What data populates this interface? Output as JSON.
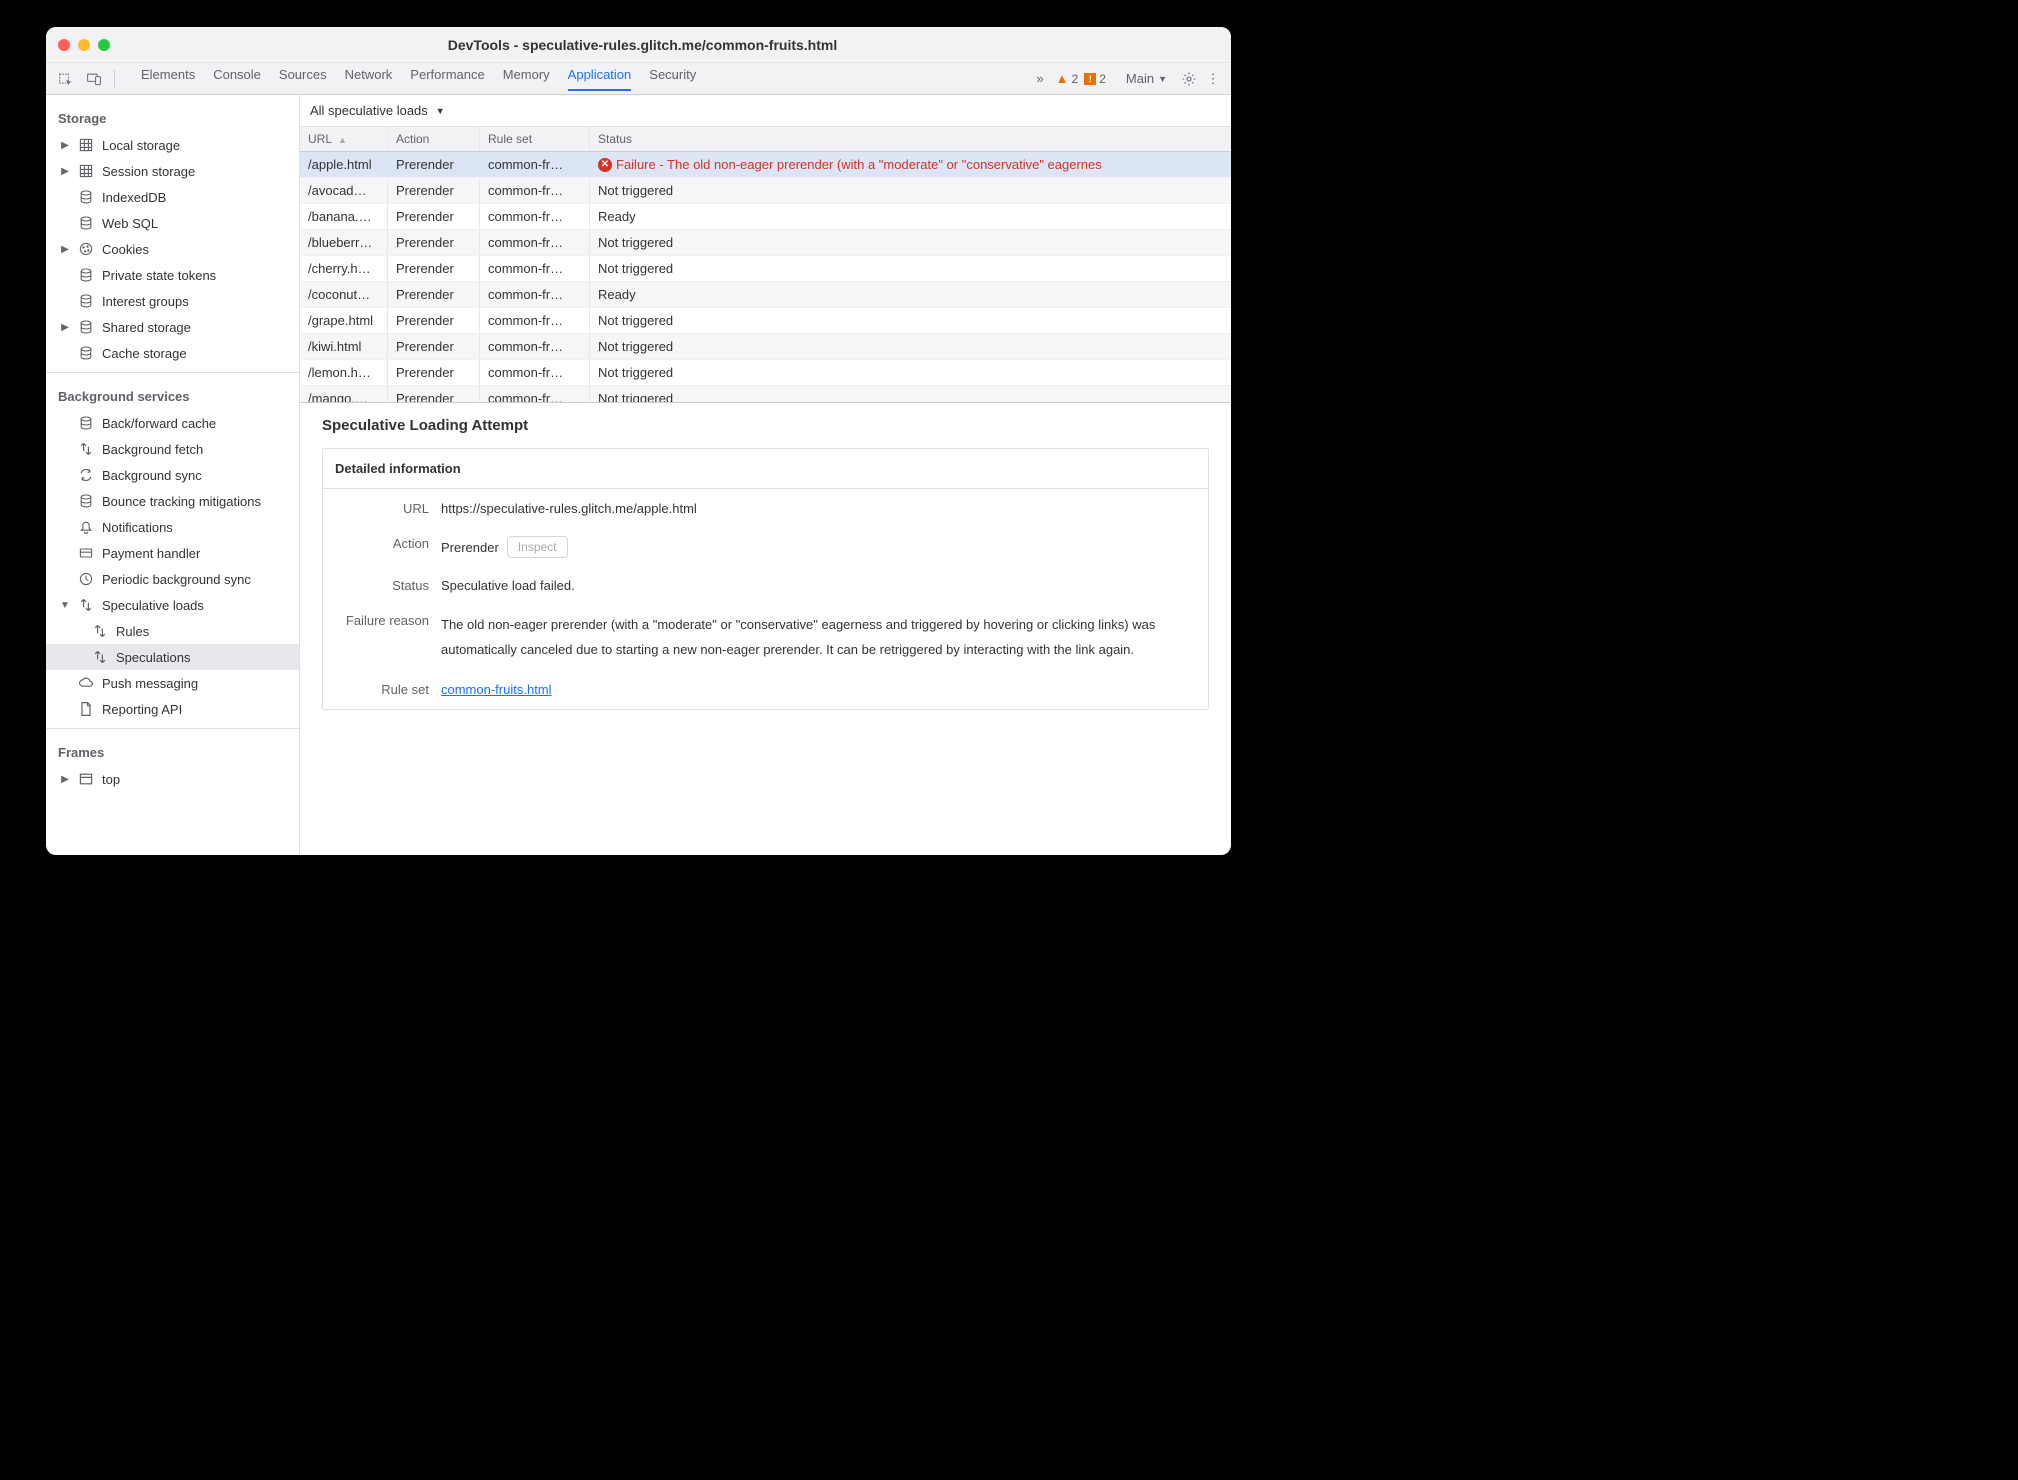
{
  "window": {
    "title": "DevTools - speculative-rules.glitch.me/common-fruits.html"
  },
  "toolbar": {
    "tabs": [
      "Elements",
      "Console",
      "Sources",
      "Network",
      "Performance",
      "Memory",
      "Application",
      "Security"
    ],
    "active_tab": "Application",
    "more": "»",
    "warnings": "2",
    "issues": "2",
    "target_label": "Main"
  },
  "sidebar": {
    "storage_h": "Storage",
    "storage_items": [
      {
        "label": "Local storage",
        "icon": "grid",
        "expand": true
      },
      {
        "label": "Session storage",
        "icon": "grid",
        "expand": true
      },
      {
        "label": "IndexedDB",
        "icon": "db",
        "expand": false
      },
      {
        "label": "Web SQL",
        "icon": "db",
        "expand": false
      },
      {
        "label": "Cookies",
        "icon": "cookie",
        "expand": true
      },
      {
        "label": "Private state tokens",
        "icon": "db",
        "expand": false
      },
      {
        "label": "Interest groups",
        "icon": "db",
        "expand": false
      },
      {
        "label": "Shared storage",
        "icon": "db",
        "expand": true
      },
      {
        "label": "Cache storage",
        "icon": "db",
        "expand": false
      }
    ],
    "bg_h": "Background services",
    "bg_items": [
      {
        "label": "Back/forward cache",
        "icon": "db"
      },
      {
        "label": "Background fetch",
        "icon": "arrows"
      },
      {
        "label": "Background sync",
        "icon": "sync"
      },
      {
        "label": "Bounce tracking mitigations",
        "icon": "db"
      },
      {
        "label": "Notifications",
        "icon": "bell"
      },
      {
        "label": "Payment handler",
        "icon": "card"
      },
      {
        "label": "Periodic background sync",
        "icon": "clock"
      }
    ],
    "spec_label": "Speculative loads",
    "spec_child1": "Rules",
    "spec_child2": "Speculations",
    "push_label": "Push messaging",
    "reporting_label": "Reporting API",
    "frames_h": "Frames",
    "frames_top": "top"
  },
  "filter": {
    "label": "All speculative loads"
  },
  "table": {
    "headers": {
      "url": "URL",
      "action": "Action",
      "ruleset": "Rule set",
      "status": "Status"
    },
    "rows": [
      {
        "url": "/apple.html",
        "action": "Prerender",
        "ruleset": "common-fr…",
        "status": "Failure - The old non-eager prerender (with a \"moderate\" or \"conservative\" eagernes",
        "err": true
      },
      {
        "url": "/avocad…",
        "action": "Prerender",
        "ruleset": "common-fr…",
        "status": "Not triggered"
      },
      {
        "url": "/banana.…",
        "action": "Prerender",
        "ruleset": "common-fr…",
        "status": "Ready"
      },
      {
        "url": "/blueberr…",
        "action": "Prerender",
        "ruleset": "common-fr…",
        "status": "Not triggered"
      },
      {
        "url": "/cherry.h…",
        "action": "Prerender",
        "ruleset": "common-fr…",
        "status": "Not triggered"
      },
      {
        "url": "/coconut…",
        "action": "Prerender",
        "ruleset": "common-fr…",
        "status": "Ready"
      },
      {
        "url": "/grape.html",
        "action": "Prerender",
        "ruleset": "common-fr…",
        "status": "Not triggered"
      },
      {
        "url": "/kiwi.html",
        "action": "Prerender",
        "ruleset": "common-fr…",
        "status": "Not triggered"
      },
      {
        "url": "/lemon.h…",
        "action": "Prerender",
        "ruleset": "common-fr…",
        "status": "Not triggered"
      },
      {
        "url": "/mango.…",
        "action": "Prerender",
        "ruleset": "common-fr…",
        "status": "Not triggered"
      }
    ]
  },
  "details": {
    "title": "Speculative Loading Attempt",
    "subtitle": "Detailed information",
    "url_k": "URL",
    "url_v": "https://speculative-rules.glitch.me/apple.html",
    "action_k": "Action",
    "action_v": "Prerender",
    "inspect": "Inspect",
    "status_k": "Status",
    "status_v": "Speculative load failed.",
    "fail_k": "Failure reason",
    "fail_v": "The old non-eager prerender (with a \"moderate\" or \"conservative\" eagerness and triggered by hovering or clicking links) was automatically canceled due to starting a new non-eager prerender. It can be retriggered by interacting with the link again.",
    "ruleset_k": "Rule set",
    "ruleset_v": "common-fruits.html"
  }
}
